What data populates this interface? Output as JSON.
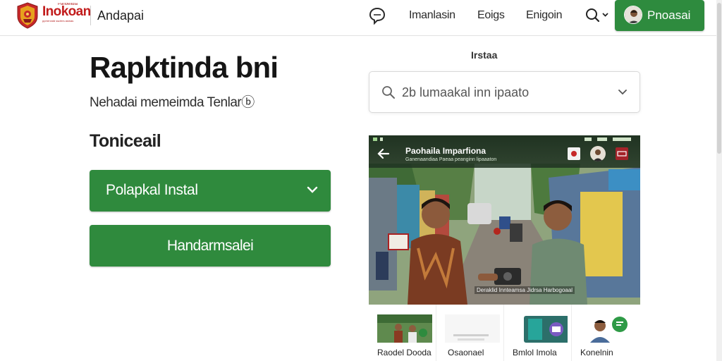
{
  "header": {
    "logo": {
      "name": "Inokoan",
      "tagline": "Panbelidia",
      "sub": "pprrenndd ssdrrrs asinas"
    },
    "site_name": "Andapai",
    "nav": [
      "Imanlasin",
      "Eoigs",
      "Enigoin"
    ],
    "account_label": "Pnoasai"
  },
  "main": {
    "title": "Rapktinda bni",
    "subtitle": "Nehadai memeimda Tenlarⓑ",
    "section_heading": "Toniceail",
    "install_select_label": "Polapkal Instal",
    "secondary_button_label": "Handarmsalei"
  },
  "search": {
    "caption": "Irstaa",
    "placeholder": "2b lumaakal inn ipaato"
  },
  "video": {
    "title": "Paohaila Imparfiona",
    "meta": "Ganenaandiaa  Paeaa  peanginn  lipaaaton",
    "caption": "Deraklid Innteamsa  Jidrsa  Harbogoaal"
  },
  "thumbnails": [
    {
      "label": "Raodel Dooda"
    },
    {
      "label": "Osaonael"
    },
    {
      "label": "Bmlol Imola"
    },
    {
      "label": "Konelnin"
    }
  ],
  "colors": {
    "primary_green": "#2f8a3d",
    "brand_red": "#c21d1d",
    "video_bar": "#203322"
  },
  "icons": {
    "chat": "chat-bubble-icon",
    "search": "search-icon",
    "chevron": "chevron-down-icon",
    "back": "arrow-left-icon"
  }
}
